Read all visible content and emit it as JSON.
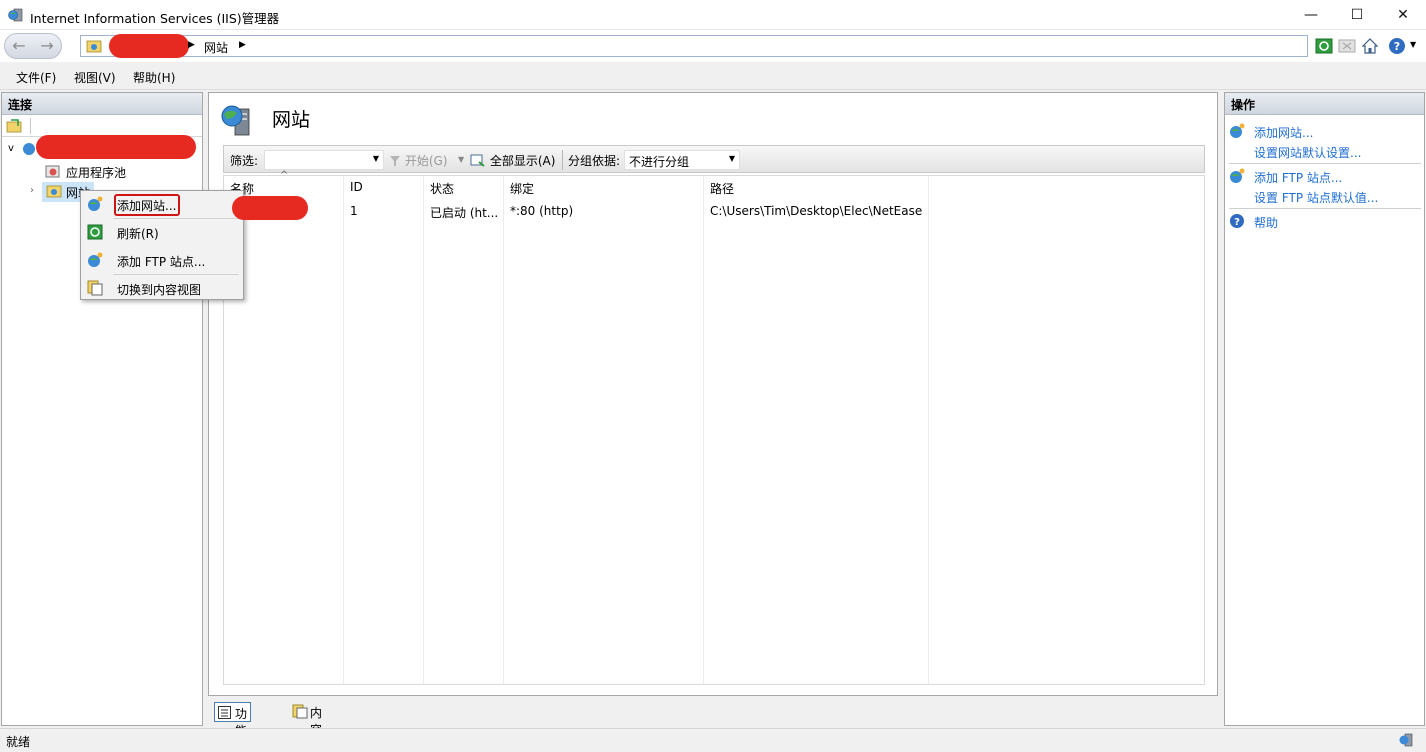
{
  "window": {
    "title": "Internet Information Services (IIS)管理器",
    "minimize": "—",
    "maximize": "☐",
    "close": "✕"
  },
  "address": {
    "breadcrumb_site": "网站",
    "arrow": "▶"
  },
  "menu": {
    "file": "文件(F)",
    "view": "视图(V)",
    "help": "帮助(H)"
  },
  "connections": {
    "header": "连接",
    "tree": {
      "app_pools": "应用程序池",
      "sites": "网站"
    }
  },
  "main": {
    "title": "网站",
    "filter_label": "筛选:",
    "start_label": "开始(G)",
    "show_all_label": "全部显示(A)",
    "group_by_label": "分组依据:",
    "group_by_value": "不进行分组",
    "columns": [
      "名称",
      "ID",
      "状态",
      "绑定",
      "路径"
    ],
    "rows": [
      {
        "name": "",
        "id": "1",
        "status": "已启动 (ht...",
        "binding": "*:80 (http)",
        "path": "C:\\Users\\Tim\\Desktop\\Elec\\NetEase"
      }
    ],
    "tab_features": "功能视图",
    "tab_content": "内容视图"
  },
  "actions": {
    "header": "操作",
    "items": [
      "添加网站...",
      "设置网站默认设置...",
      "添加 FTP 站点...",
      "设置 FTP 站点默认值...",
      "帮助"
    ]
  },
  "context_menu": {
    "items": [
      "添加网站...",
      "刷新(R)",
      "添加 FTP 站点...",
      "切换到内容视图"
    ]
  },
  "status": {
    "text": "就绪"
  },
  "colors": {
    "link": "#1f6ed4",
    "redaction": "#e62a22",
    "highlight": "#d01414"
  }
}
